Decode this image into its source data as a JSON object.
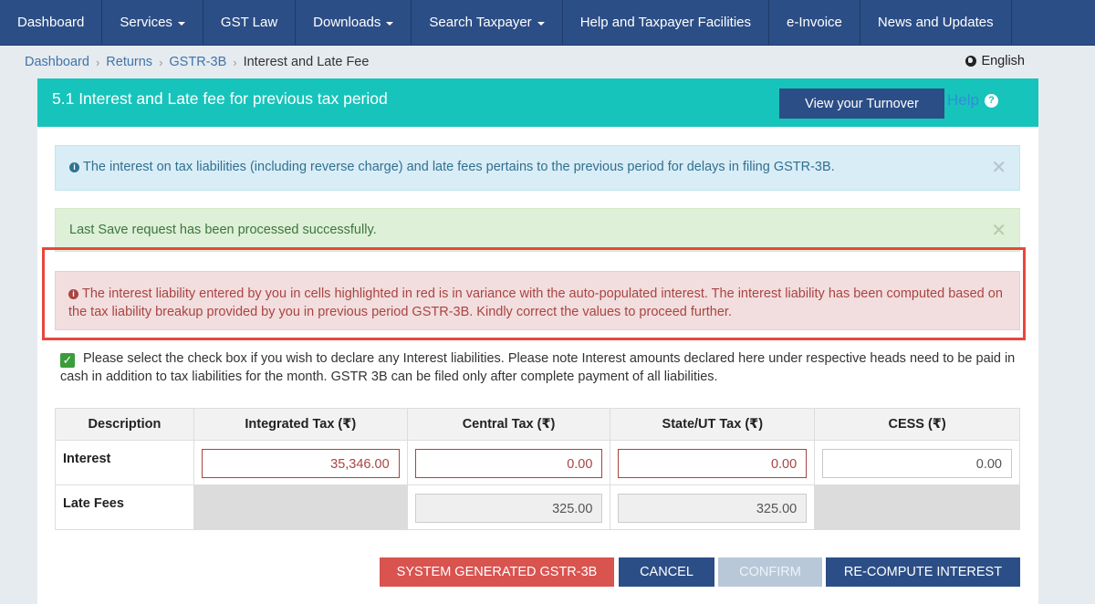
{
  "nav": {
    "items": [
      {
        "label": "Dashboard",
        "dropdown": false
      },
      {
        "label": "Services",
        "dropdown": true
      },
      {
        "label": "GST Law",
        "dropdown": false
      },
      {
        "label": "Downloads",
        "dropdown": true
      },
      {
        "label": "Search Taxpayer",
        "dropdown": true
      },
      {
        "label": "Help and Taxpayer Facilities",
        "dropdown": false
      },
      {
        "label": "e-Invoice",
        "dropdown": false
      },
      {
        "label": "News and Updates",
        "dropdown": false
      }
    ]
  },
  "breadcrumb": {
    "items": [
      "Dashboard",
      "Returns",
      "GSTR-3B"
    ],
    "current": "Interest and Late Fee"
  },
  "language": "English",
  "card": {
    "title": "5.1 Interest and Late fee for previous tax period",
    "turnover_button": "View your Turnover",
    "help_label": "Help"
  },
  "alerts": {
    "info": "The interest on tax liabilities (including reverse charge) and late fees pertains to the previous period for delays in filing GSTR-3B.",
    "success": "Last Save request has been processed successfully.",
    "danger": "The interest liability entered by you in cells highlighted in red is in variance with the auto-populated interest. The interest liability has been computed based on the tax liability breakup provided by you in previous period GSTR-3B. Kindly correct the values to proceed further."
  },
  "declare_text": "Please select the check box if you wish to declare any Interest liabilities. Please note Interest amounts declared here under respective heads need to be paid in cash in addition to tax liabilities for the month. GSTR 3B can be filed only after complete payment of all liabilities.",
  "declare_checked": true,
  "table": {
    "headers": [
      "Description",
      "Integrated Tax (₹)",
      "Central Tax (₹)",
      "State/UT Tax (₹)",
      "CESS (₹)"
    ],
    "interest": {
      "label": "Interest",
      "integrated": "35,346.00",
      "central": "0.00",
      "state": "0.00",
      "cess": "0.00"
    },
    "late_fees": {
      "label": "Late Fees",
      "central": "325.00",
      "state": "325.00"
    }
  },
  "buttons": {
    "system_generated": "SYSTEM GENERATED GSTR-3B",
    "cancel": "CANCEL",
    "confirm": "CONFIRM",
    "recompute": "RE-COMPUTE INTEREST"
  },
  "colors": {
    "nav_bg": "#2c4e86",
    "header_teal": "#17c4bb",
    "danger_red": "#d9534f",
    "highlight_border": "#e8473b"
  }
}
